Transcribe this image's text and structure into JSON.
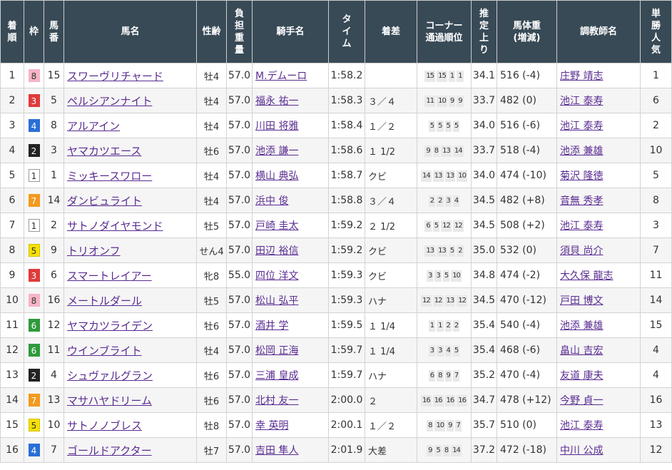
{
  "headers": {
    "rank": [
      "着",
      "順"
    ],
    "waku": "枠",
    "umaban": [
      "馬",
      "番"
    ],
    "horse": "馬名",
    "sexage": "性齢",
    "weight": [
      "負",
      "担",
      "重",
      "量"
    ],
    "jockey": "騎手名",
    "time": [
      "タ",
      "イ",
      "ム"
    ],
    "margin": "着差",
    "corner": [
      "コーナー",
      "通過順位"
    ],
    "last3f": [
      "推",
      "定",
      "上",
      "り"
    ],
    "body": [
      "馬体重",
      "(増減)"
    ],
    "trainer": "調教師名",
    "pop": [
      "単",
      "勝",
      "人",
      "気"
    ]
  },
  "waku_colors": {
    "1": {
      "bg": "#ffffff",
      "fg": "#333333",
      "border": "#999999"
    },
    "2": {
      "bg": "#222222",
      "fg": "#ffffff",
      "border": "#222222"
    },
    "3": {
      "bg": "#e03a3a",
      "fg": "#ffffff",
      "border": "#e03a3a"
    },
    "4": {
      "bg": "#2a6fd6",
      "fg": "#ffffff",
      "border": "#2a6fd6"
    },
    "5": {
      "bg": "#f5e100",
      "fg": "#333333",
      "border": "#d4c200"
    },
    "6": {
      "bg": "#2e9a3c",
      "fg": "#ffffff",
      "border": "#2e9a3c"
    },
    "7": {
      "bg": "#f39a1e",
      "fg": "#ffffff",
      "border": "#f39a1e"
    },
    "8": {
      "bg": "#f7b4c6",
      "fg": "#333333",
      "border": "#f7b4c6"
    }
  },
  "rows": [
    {
      "rank": "1",
      "waku": "8",
      "umaban": "15",
      "horse": "スワーヴリチャード",
      "sexage": "牡4",
      "weight": "57.0",
      "jockey": "M.デムーロ",
      "time": "1:58.2",
      "margin": "",
      "corner": [
        "15",
        "15",
        "1",
        "1"
      ],
      "last3f": "34.1",
      "body": "516 (-4)",
      "trainer": "庄野 靖志",
      "pop": "1"
    },
    {
      "rank": "2",
      "waku": "3",
      "umaban": "5",
      "horse": "ペルシアンナイト",
      "sexage": "牡4",
      "weight": "57.0",
      "jockey": "福永 祐一",
      "time": "1:58.3",
      "margin": "３／４",
      "corner": [
        "11",
        "10",
        "9",
        "9"
      ],
      "last3f": "33.7",
      "body": "482 (0)",
      "trainer": "池江 泰寿",
      "pop": "6"
    },
    {
      "rank": "3",
      "waku": "4",
      "umaban": "8",
      "horse": "アルアイン",
      "sexage": "牡4",
      "weight": "57.0",
      "jockey": "川田 将雅",
      "time": "1:58.4",
      "margin": "１／２",
      "corner": [
        "5",
        "5",
        "5",
        "5"
      ],
      "last3f": "34.0",
      "body": "516 (-6)",
      "trainer": "池江 泰寿",
      "pop": "2"
    },
    {
      "rank": "4",
      "waku": "2",
      "umaban": "3",
      "horse": "ヤマカツエース",
      "sexage": "牡6",
      "weight": "57.0",
      "jockey": "池添 謙一",
      "time": "1:58.6",
      "margin": "１ 1/2",
      "corner": [
        "9",
        "8",
        "13",
        "14"
      ],
      "last3f": "33.7",
      "body": "518 (-4)",
      "trainer": "池添 兼雄",
      "pop": "10"
    },
    {
      "rank": "5",
      "waku": "1",
      "umaban": "1",
      "horse": "ミッキースワロー",
      "sexage": "牡4",
      "weight": "57.0",
      "jockey": "横山 典弘",
      "time": "1:58.7",
      "margin": "クビ",
      "corner": [
        "14",
        "13",
        "13",
        "10"
      ],
      "last3f": "34.0",
      "body": "474 (-10)",
      "trainer": "菊沢 隆徳",
      "pop": "5"
    },
    {
      "rank": "6",
      "waku": "7",
      "umaban": "14",
      "horse": "ダンビュライト",
      "sexage": "牡4",
      "weight": "57.0",
      "jockey": "浜中 俊",
      "time": "1:58.8",
      "margin": "３／４",
      "corner": [
        "2",
        "2",
        "3",
        "4"
      ],
      "last3f": "34.5",
      "body": "482 (+8)",
      "trainer": "音無 秀孝",
      "pop": "8"
    },
    {
      "rank": "7",
      "waku": "1",
      "umaban": "2",
      "horse": "サトノダイヤモンド",
      "sexage": "牡5",
      "weight": "57.0",
      "jockey": "戸崎 圭太",
      "time": "1:59.2",
      "margin": "２ 1/2",
      "corner": [
        "6",
        "5",
        "12",
        "12"
      ],
      "last3f": "34.5",
      "body": "508 (+2)",
      "trainer": "池江 泰寿",
      "pop": "3"
    },
    {
      "rank": "8",
      "waku": "5",
      "umaban": "9",
      "horse": "トリオンフ",
      "sexage": "せん4",
      "weight": "57.0",
      "jockey": "田辺 裕信",
      "time": "1:59.2",
      "margin": "クビ",
      "corner": [
        "13",
        "13",
        "5",
        "2"
      ],
      "last3f": "35.0",
      "body": "532 (0)",
      "trainer": "須貝 尚介",
      "pop": "7"
    },
    {
      "rank": "9",
      "waku": "3",
      "umaban": "6",
      "horse": "スマートレイアー",
      "sexage": "牝8",
      "weight": "55.0",
      "jockey": "四位 洋文",
      "time": "1:59.3",
      "margin": "クビ",
      "corner": [
        "3",
        "3",
        "5",
        "10"
      ],
      "last3f": "34.8",
      "body": "474 (-2)",
      "trainer": "大久保 龍志",
      "pop": "11"
    },
    {
      "rank": "10",
      "waku": "8",
      "umaban": "16",
      "horse": "メートルダール",
      "sexage": "牡5",
      "weight": "57.0",
      "jockey": "松山 弘平",
      "time": "1:59.3",
      "margin": "ハナ",
      "corner": [
        "12",
        "12",
        "13",
        "12"
      ],
      "last3f": "34.5",
      "body": "470 (-12)",
      "trainer": "戸田 博文",
      "pop": "14"
    },
    {
      "rank": "11",
      "waku": "6",
      "umaban": "12",
      "horse": "ヤマカツライデン",
      "sexage": "牡6",
      "weight": "57.0",
      "jockey": "酒井 学",
      "time": "1:59.5",
      "margin": "１ 1/4",
      "corner": [
        "1",
        "1",
        "2",
        "2"
      ],
      "last3f": "35.4",
      "body": "540 (-4)",
      "trainer": "池添 兼雄",
      "pop": "15"
    },
    {
      "rank": "12",
      "waku": "6",
      "umaban": "11",
      "horse": "ウインブライト",
      "sexage": "牡4",
      "weight": "57.0",
      "jockey": "松岡 正海",
      "time": "1:59.7",
      "margin": "１ 1/4",
      "corner": [
        "3",
        "3",
        "4",
        "5"
      ],
      "last3f": "35.4",
      "body": "468 (-6)",
      "trainer": "畠山 吉宏",
      "pop": "4"
    },
    {
      "rank": "13",
      "waku": "2",
      "umaban": "4",
      "horse": "シュヴァルグラン",
      "sexage": "牡6",
      "weight": "57.0",
      "jockey": "三浦 皇成",
      "time": "1:59.7",
      "margin": "ハナ",
      "corner": [
        "6",
        "8",
        "9",
        "7"
      ],
      "last3f": "35.2",
      "body": "470 (-4)",
      "trainer": "友道 康夫",
      "pop": "4"
    },
    {
      "rank": "14",
      "waku": "7",
      "umaban": "13",
      "horse": "マサハヤドリーム",
      "sexage": "牡6",
      "weight": "57.0",
      "jockey": "北村 友一",
      "time": "2:00.0",
      "margin": "２",
      "corner": [
        "16",
        "16",
        "16",
        "16"
      ],
      "last3f": "34.7",
      "body": "478 (+12)",
      "trainer": "今野 貞一",
      "pop": "16"
    },
    {
      "rank": "15",
      "waku": "5",
      "umaban": "10",
      "horse": "サトノノブレス",
      "sexage": "牡8",
      "weight": "57.0",
      "jockey": "幸 英明",
      "time": "2:00.1",
      "margin": "１／２",
      "corner": [
        "8",
        "10",
        "9",
        "7"
      ],
      "last3f": "35.7",
      "body": "510 (0)",
      "trainer": "池江 泰寿",
      "pop": "13"
    },
    {
      "rank": "16",
      "waku": "4",
      "umaban": "7",
      "horse": "ゴールドアクター",
      "sexage": "牡7",
      "weight": "57.0",
      "jockey": "吉田 隼人",
      "time": "2:01.9",
      "margin": "大差",
      "corner": [
        "9",
        "5",
        "8",
        "14"
      ],
      "last3f": "37.2",
      "body": "472 (-18)",
      "trainer": "中川 公成",
      "pop": "12"
    }
  ]
}
